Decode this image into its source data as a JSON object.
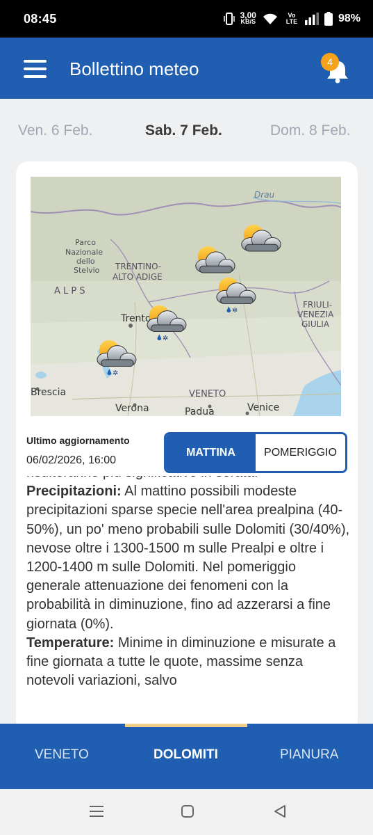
{
  "status_bar": {
    "time": "08:45",
    "net_speed": "3,00",
    "net_unit": "KB/S",
    "volte": "Vo LTE",
    "battery": "98%"
  },
  "app_bar": {
    "title": "Bollettino meteo",
    "notification_count": "4"
  },
  "date_tabs": {
    "prev": "Ven. 6 Feb.",
    "current": "Sab. 7 Feb.",
    "next": "Dom. 8 Feb."
  },
  "map": {
    "labels": {
      "drau": "Drau",
      "park_1": "Parco",
      "park_2": "Nazionale",
      "park_3": "dello",
      "park_4": "Stelvio",
      "region_1": "TRENTINO-",
      "region_2": "ALTO ADIGE",
      "alps": "A L P S",
      "trento": "Trento",
      "friuli_1": "FRIULI-",
      "friuli_2": "VENEZIA",
      "friuli_3": "GIULIA",
      "brescia": "Brescia",
      "veneto": "VENETO",
      "verona": "Verona",
      "padua": "Padua",
      "venice": "Venice"
    },
    "icons": [
      "partly-cloudy-icon",
      "partly-cloudy-icon",
      "rain-snow-icon",
      "rain-snow-icon",
      "rain-snow-icon"
    ]
  },
  "update": {
    "label": "Ultimo aggiornamento",
    "value": "06/02/2026, 16:00"
  },
  "toggle": {
    "morning": "MATTINA",
    "afternoon": "POMERIGGIO"
  },
  "bulletin": {
    "line_top": "risulteranno più significative in serata.",
    "precip_label": "Precipitazioni:",
    "precip_text": " Al mattino possibili modeste precipitazioni sparse specie nell'area prealpina (40-50%), un po' meno probabili sulle Dolomiti (30/40%), nevose oltre i 1300-1500 m sulle Prealpi e oltre i 1200-1400 m sulle Dolomiti. Nel pomeriggio generale attenuazione dei fenomeni con la probabilità in diminuzione, fino ad azzerarsi a fine giornata (0%).",
    "temp_label": "Temperature:",
    "temp_text": " Minime in diminuzione e misurate a fine giornata a tutte le quote, massime senza notevoli variazioni, salvo"
  },
  "bottom_nav": {
    "veneto": "VENETO",
    "dolomiti": "DOLOMITI",
    "pianura": "PIANURA"
  },
  "colors": {
    "primary": "#1f5eb0",
    "badge": "#f7a21b",
    "inactive_date": "#9fa8b2"
  }
}
